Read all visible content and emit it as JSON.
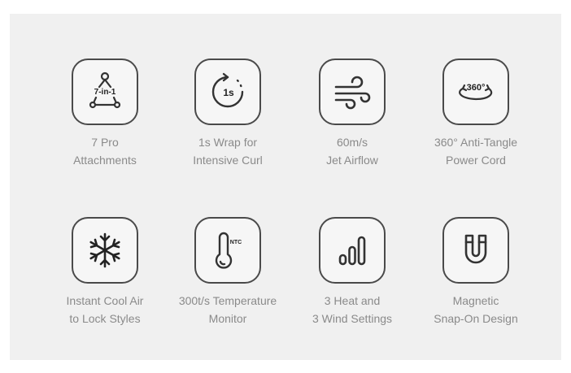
{
  "features": [
    {
      "icon": "attachments-icon",
      "icon_text": "7-in-1",
      "line1": "7 Pro",
      "line2": "Attachments"
    },
    {
      "icon": "timer-icon",
      "icon_text": "1s",
      "line1": "1s Wrap for",
      "line2": "Intensive Curl"
    },
    {
      "icon": "airflow-icon",
      "line1": "60m/s",
      "line2": "Jet Airflow"
    },
    {
      "icon": "rotate-360-icon",
      "icon_text": "360°",
      "line1": "360° Anti-Tangle",
      "line2": "Power Cord"
    },
    {
      "icon": "snowflake-icon",
      "line1": "Instant Cool Air",
      "line2": "to Lock Styles"
    },
    {
      "icon": "thermometer-icon",
      "icon_text": "NTC",
      "line1": "300t/s Temperature",
      "line2": "Monitor"
    },
    {
      "icon": "signal-bars-icon",
      "line1": "3 Heat and",
      "line2": "3 Wind Settings"
    },
    {
      "icon": "magnet-icon",
      "line1": "Magnetic",
      "line2": "Snap-On Design"
    }
  ],
  "colors": {
    "panel": "#f0f0f0",
    "stroke": "#4a4a4a",
    "label": "#8a8a8a"
  }
}
